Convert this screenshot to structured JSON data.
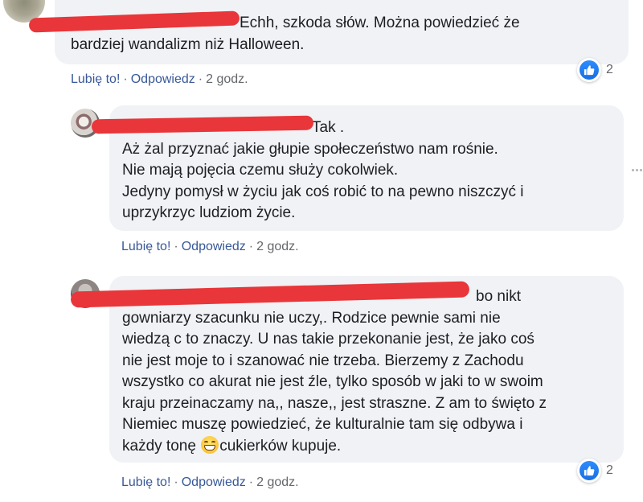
{
  "comments": [
    {
      "first_line": "Echh, szkoda słów. Można powiedzieć że",
      "lines": [
        "bardziej wandalizm niż Halloween."
      ],
      "actions": {
        "like": "Lubię to!",
        "reply": "Odpowiedz",
        "time": "2 godz."
      },
      "reactions": {
        "icon": "like-icon",
        "count": "2"
      }
    },
    {
      "first_line": "Tak .",
      "lines": [
        "Aż żal przyznać jakie głupie społeczeństwo nam rośnie.",
        "Nie mają pojęcia czemu służy cokolwiek.",
        "Jedyny pomysł w życiu jak coś robić to na pewno niszczyć i",
        "uprzykrzyc ludziom życie."
      ],
      "actions": {
        "like": "Lubię to!",
        "reply": "Odpowiedz",
        "time": "2 godz."
      }
    },
    {
      "first_line": "bo nikt",
      "lines": [
        "gowniarzy szacunku nie uczy,. Rodzice pewnie sami nie",
        "wiedzą c to znaczy. U nas takie przekonanie jest, że jako coś",
        "nie jest moje to i szanować nie trzeba. Bierzemy z Zachodu",
        "wszystko co akurat nie jest źle, tylko sposób w jaki to w swoim",
        "kraju przeinaczamy na,, nasze,, jest straszne. Z am to święto z",
        "Niemiec muszę powiedzieć, że kulturalnie tam się odbywa i"
      ],
      "last_line_before": "każdy tonę",
      "emoji": "grinning-face-emoji",
      "last_line_after": "cukierków kupuje.",
      "actions": {
        "like": "Lubię to!",
        "reply": "Odpowiedz",
        "time": "2 godz."
      },
      "reactions": {
        "icon": "like-icon",
        "count": "2"
      }
    }
  ],
  "separator": "·",
  "colors": {
    "bubble": "#f0f2f5",
    "link": "#385898",
    "meta": "#65676b",
    "like": "#1a6fe0",
    "redaction": "#e8363a"
  }
}
